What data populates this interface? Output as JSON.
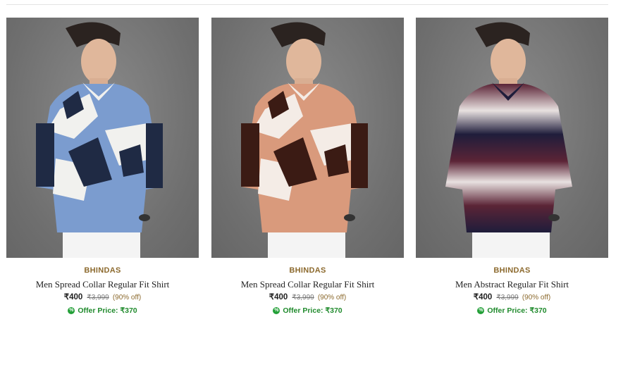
{
  "products": [
    {
      "brand": "BHINDAS",
      "name": "Men Spread Collar Regular Fit Shirt",
      "price": "₹400",
      "mrp": "₹3,999",
      "discount": "(90% off)",
      "offer": "Offer Price: ₹370",
      "image": "model-blue-white-black-camo-shirt",
      "colors": {
        "shirt_main": "#7b9ccf",
        "shirt_light": "#f1f1ee",
        "shirt_dark": "#1f2a44"
      }
    },
    {
      "brand": "BHINDAS",
      "name": "Men Spread Collar Regular Fit Shirt",
      "price": "₹400",
      "mrp": "₹3,999",
      "discount": "(90% off)",
      "offer": "Offer Price: ₹370",
      "image": "model-peach-white-brown-camo-shirt",
      "colors": {
        "shirt_main": "#d99a7c",
        "shirt_light": "#f4ece6",
        "shirt_dark": "#3b1b14"
      }
    },
    {
      "brand": "BHINDAS",
      "name": "Men Abstract Regular Fit Shirt",
      "price": "₹400",
      "mrp": "₹3,999",
      "discount": "(90% off)",
      "offer": "Offer Price: ₹370",
      "image": "model-maroon-white-navy-tie-dye-shirt",
      "colors": {
        "shirt_main": "#5b2436",
        "shirt_light": "#e8e1e0",
        "shirt_dark": "#1f1d3b"
      }
    }
  ],
  "theme": {
    "brand_color": "#8c6a2e",
    "offer_color": "#1f8a2c"
  }
}
